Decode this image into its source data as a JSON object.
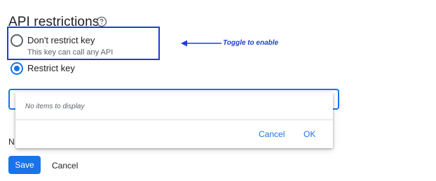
{
  "section": {
    "title": "API restrictions",
    "help_icon": "help-circle-icon"
  },
  "options": [
    {
      "label": "Don't restrict key",
      "sublabel": "This key can call any API",
      "selected": false
    },
    {
      "label": "Restrict key",
      "selected": true
    }
  ],
  "annotation": {
    "text": "Toggle to enable",
    "color": "#1f3ed6"
  },
  "api_select": {
    "empty_message": "No items to display",
    "cancel_label": "Cancel",
    "ok_label": "OK",
    "accent_color": "#1a73e8"
  },
  "partial_text": "N",
  "footer": {
    "save_label": "Save",
    "cancel_label": "Cancel"
  }
}
